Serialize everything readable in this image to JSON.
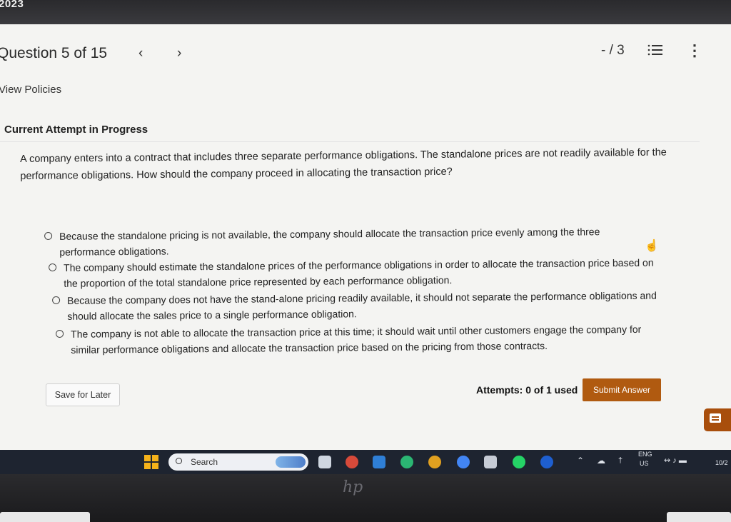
{
  "top_bar": {
    "year_text": "2023"
  },
  "header": {
    "question_label": "Question 5 of 15",
    "prev_icon": "chevron-left",
    "next_icon": "chevron-right",
    "score": "- / 3",
    "list_icon": "list-icon",
    "more_icon": "more-vertical"
  },
  "policies_link": "View Policies",
  "attempt_status": "Current Attempt in Progress",
  "question": {
    "text": "A company enters into a contract that includes three separate performance obligations. The standalone prices are not readily available for the performance obligations. How should the company proceed in allocating the transaction price?",
    "options": [
      {
        "label": "Because the standalone pricing is not available, the company should allocate the transaction price evenly among the three performance obligations."
      },
      {
        "label": "The company should estimate the standalone prices of the performance obligations in order to allocate the transaction price based on the proportion of the total standalone price represented by each performance obligation."
      },
      {
        "label": "Because the company does not have the stand-alone pricing readily available, it should not separate the performance obligations and should allocate the sales price to a single performance obligation."
      },
      {
        "label": "The company is not able to allocate the transaction price at this time; it should wait until other customers engage the company for similar performance obligations and allocate the transaction price based on the pricing from those contracts."
      }
    ]
  },
  "footer": {
    "save_label": "Save for Later",
    "attempts_label": "Attempts: 0 of 1 used",
    "submit_label": "Submit Answer"
  },
  "taskbar": {
    "search_label": "Search",
    "lang_line1": "ENG",
    "lang_line2": "US",
    "date_fragment": "10/2"
  },
  "colors": {
    "accent": "#b05a10",
    "page_bg": "#f4f4f2",
    "taskbar_bg": "#1e2430"
  }
}
